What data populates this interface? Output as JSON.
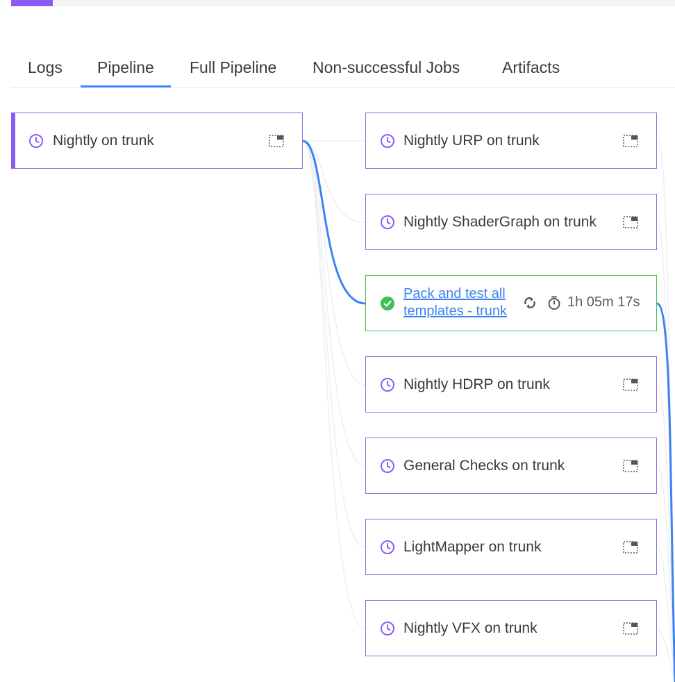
{
  "tabs": [
    {
      "label": "Logs"
    },
    {
      "label": "Pipeline"
    },
    {
      "label": "Full Pipeline"
    },
    {
      "label": "Non-successful Jobs"
    },
    {
      "label": "Artifacts"
    }
  ],
  "active_tab": "Pipeline",
  "root_job": {
    "title": "Nightly on trunk",
    "status": "scheduled"
  },
  "jobs": [
    {
      "title": "Nightly URP on trunk",
      "status": "scheduled"
    },
    {
      "title": "Nightly ShaderGraph on trunk",
      "status": "scheduled"
    },
    {
      "title": "Pack and test all templates - trunk",
      "status": "success",
      "duration": "1h 05m 17s"
    },
    {
      "title": "Nightly HDRP on trunk",
      "status": "scheduled"
    },
    {
      "title": "General Checks on trunk",
      "status": "scheduled"
    },
    {
      "title": "LightMapper on trunk",
      "status": "scheduled"
    },
    {
      "title": "Nightly VFX on trunk",
      "status": "scheduled"
    }
  ],
  "colors": {
    "accent": "#8a5cf6",
    "link": "#3b82f6",
    "success": "#3fbf55",
    "edge_active": "#3b82f6",
    "edge_inactive": "#eceef0"
  },
  "icons": {
    "scheduled": "clock-icon",
    "success": "check-circle-icon",
    "menu": "expand-window-icon",
    "retry": "retry-icon",
    "duration": "stopwatch-icon"
  }
}
